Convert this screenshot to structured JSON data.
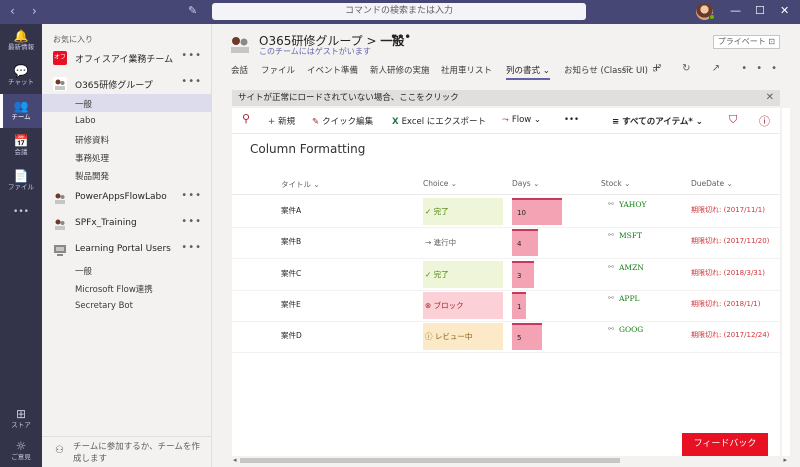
{
  "titlebar": {
    "search_placeholder": "コマンドの検索または入力",
    "back_glyph": "‹",
    "forward_glyph": "›",
    "compose_glyph": "✎",
    "minimize_glyph": "—",
    "maximize_glyph": "☐",
    "close_glyph": "✕"
  },
  "rail": {
    "items": [
      {
        "label": "最新情報",
        "icon": "bell-icon",
        "glyph": "🔔"
      },
      {
        "label": "チャット",
        "icon": "chat-icon",
        "glyph": "💬"
      },
      {
        "label": "チーム",
        "icon": "teams-icon",
        "glyph": "👥"
      },
      {
        "label": "会議",
        "icon": "calendar-icon",
        "glyph": "📅"
      },
      {
        "label": "ファイル",
        "icon": "files-icon",
        "glyph": "📄"
      },
      {
        "label": "",
        "icon": "more-icon",
        "glyph": "•••"
      },
      {
        "label": "ストア",
        "icon": "store-icon",
        "glyph": "⊞"
      },
      {
        "label": "ご意見",
        "icon": "feedback-icon",
        "glyph": "☼"
      }
    ]
  },
  "teams_list": {
    "favorites_header": "お気に入り",
    "teams": [
      {
        "name": "オフィスアイ業務チーム",
        "logo_text": "オフ",
        "logo_color": "#e81123",
        "channels": []
      },
      {
        "name": "O365研修グループ",
        "logo_text": "",
        "logo_color": "#ffffff",
        "channels": [
          "一般",
          "Labo",
          "研修資料",
          "事務処理",
          "製品開発"
        ]
      },
      {
        "name": "PowerAppsFlowLabo",
        "logo_text": "",
        "logo_color": "#ffffff",
        "channels": []
      },
      {
        "name": "SPFx_Training",
        "logo_text": "",
        "logo_color": "#ffffff",
        "channels": []
      },
      {
        "name": "Learning Portal Users",
        "logo_text": "",
        "logo_color": "#ffffff",
        "channels": [
          "一般",
          "Microsoft Flow連携",
          "Secretary Bot"
        ]
      }
    ],
    "more_glyph": "•••",
    "join_text": "チームに参加するか、チームを作成します",
    "join_glyph": "⚇"
  },
  "channel": {
    "team_name": "O365研修グループ",
    "separator": " > ",
    "channel_name": "一般",
    "more_glyph": "•••",
    "guest_note": "このチームにはゲストがいます",
    "privacy": "プライベート",
    "privacy_glyph": "⊡"
  },
  "tabs": [
    {
      "label": "会話"
    },
    {
      "label": "ファイル"
    },
    {
      "label": "イベント準備"
    },
    {
      "label": "新人研修の実施"
    },
    {
      "label": "社用車リスト"
    },
    {
      "label": "列の書式 ⌄"
    },
    {
      "label": "お知らせ (Classic UI)"
    },
    {
      "label": "+"
    }
  ],
  "tab_icons": "▭ ⤢ ↻ ↗ •••",
  "banner": {
    "text": "サイトが正常にロードされていない場合、ここをクリック",
    "close_glyph": "✕"
  },
  "commands": {
    "search_glyph": "⚲",
    "new_glyph": "+",
    "new": "新規",
    "quick_edit_glyph": "✎",
    "quick_edit": "クイック編集",
    "excel_glyph": "X",
    "export_excel": "Excel にエクスポート",
    "flow_glyph": "⤳",
    "flow": "Flow ⌄",
    "more": "•••",
    "view_glyph": "≡",
    "view": "すべてのアイテム* ⌄",
    "filter_glyph": "⛉",
    "info_glyph": "ⓘ"
  },
  "list": {
    "title": "Column Formatting",
    "columns": [
      "タイトル ⌄",
      "Choice ⌄",
      "Days ⌄",
      "Stock ⌄",
      "DueDate ⌄"
    ],
    "stock_link_glyph": "⚯",
    "rows": [
      {
        "title": "案件A",
        "choice": "✓ 完了",
        "choice_state": "done",
        "days": "10",
        "days_fraction": 0.62,
        "stock": "YAHOY",
        "due": "期限切れ: (2017/11/1)"
      },
      {
        "title": "案件B",
        "choice": "→ 進行中",
        "choice_state": "progress",
        "days": "4",
        "days_fraction": 0.33,
        "stock": "MSFT",
        "due": "期限切れ: (2017/11/20)"
      },
      {
        "title": "案件C",
        "choice": "✓ 完了",
        "choice_state": "done",
        "days": "3",
        "days_fraction": 0.28,
        "stock": "AMZN",
        "due": "期限切れ: (2018/3/31)"
      },
      {
        "title": "案件E",
        "choice": "⊗ ブロック",
        "choice_state": "blocked",
        "days": "1",
        "days_fraction": 0.17,
        "stock": "APPL",
        "due": "期限切れ: (2018/1/1)"
      },
      {
        "title": "案件D",
        "choice": "ⓘ レビュー中",
        "choice_state": "review",
        "days": "5",
        "days_fraction": 0.38,
        "stock": "GOOG",
        "due": "期限切れ: (2017/12/24)"
      }
    ]
  },
  "feedback_button": "フィードバック",
  "scroll": {
    "left_glyph": "◂",
    "right_glyph": "▸"
  },
  "colors": {
    "titlebar": "#464775",
    "rail": "#33344a",
    "accent": "#6264a7",
    "feedback": "#e81123",
    "days_bar": "#f4a3b5",
    "overdue": "#d13438"
  }
}
